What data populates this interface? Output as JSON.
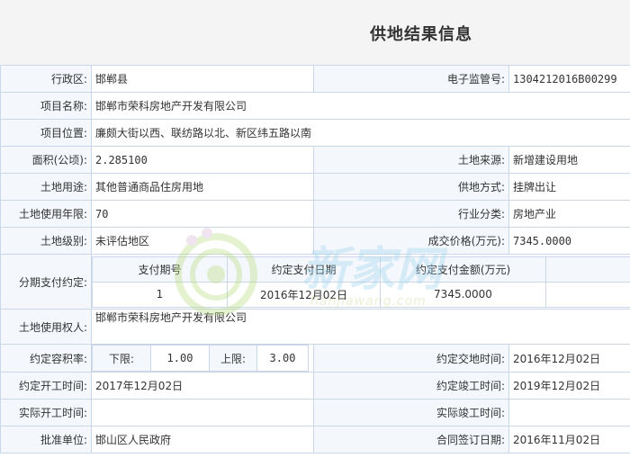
{
  "title": "供地结果信息",
  "labels": {
    "district": "行政区:",
    "supervision_no": "电子监管号:",
    "project_name": "项目名称:",
    "project_location": "项目位置:",
    "area": "面积(公顷):",
    "land_source": "土地来源:",
    "land_use": "土地用途:",
    "supply_method": "供地方式:",
    "use_years": "土地使用年限:",
    "industry": "行业分类:",
    "land_grade": "土地级别:",
    "price": "成交价格(万元):",
    "installment": "分期支付约定:",
    "land_user": "土地使用权人:",
    "plot_ratio": "约定容积率:",
    "agreed_delivery_time": "约定交地时间:",
    "agreed_start_time": "约定开工时间:",
    "agreed_completion_time": "约定竣工时间:",
    "actual_start_time": "实际开工时间:",
    "actual_completion_time": "实际竣工时间:",
    "approval_unit": "批准单位:",
    "contract_date": "合同签订日期:"
  },
  "values": {
    "district": "邯郸县",
    "supervision_no": "1304212016B00299",
    "project_name": "邯郸市荣科房地产开发有限公司",
    "project_location": "廉颇大街以西、联纺路以北、新区纬五路以南",
    "area": "2.285100",
    "land_source": "新增建设用地",
    "land_use": "其他普通商品住房用地",
    "supply_method": "挂牌出让",
    "use_years": "70",
    "industry": "房地产业",
    "land_grade": "未评估地区",
    "price": "7345.0000",
    "land_user": "邯郸市荣科房地产开发有限公司",
    "agreed_delivery_time": "2016年12月02日",
    "agreed_start_time": "2017年12月02日",
    "agreed_completion_time": "2019年12月02日",
    "actual_start_time": "",
    "actual_completion_time": "",
    "approval_unit": "邯山区人民政府",
    "contract_date": "2016年11月02日"
  },
  "installments": {
    "headers": [
      "支付期号",
      "约定支付日期",
      "约定支付金额(万元)"
    ],
    "rows": [
      {
        "period": "1",
        "date": "2016年12月02日",
        "amount": "7345.0000"
      }
    ]
  },
  "plot_ratio": {
    "lower_label": "下限:",
    "lower_value": "1.00",
    "upper_label": "上限:",
    "upper_value": "3.00"
  },
  "watermark": {
    "brand": "新家网",
    "domain": "hanjiawang.com"
  }
}
